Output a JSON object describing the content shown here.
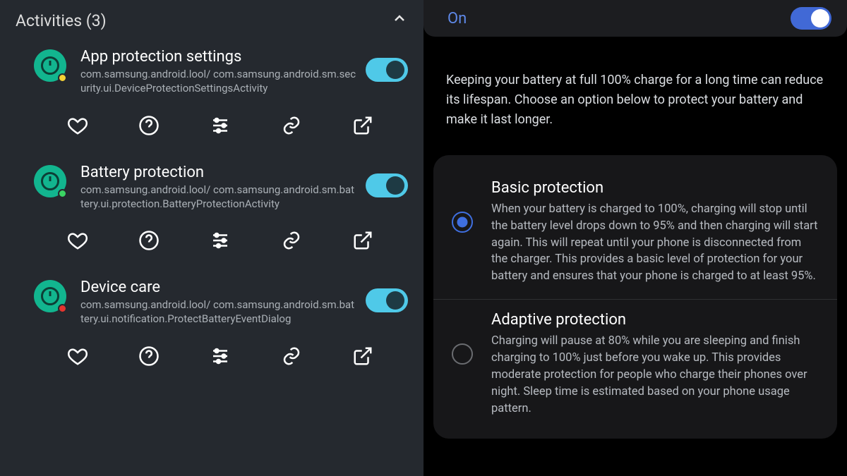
{
  "left": {
    "section_title": "Activities (3)",
    "items": [
      {
        "title": "App protection settings",
        "subtitle": "com.samsung.android.lool/\ncom.samsung.android.sm.security.ui.DeviceProtectionSettingsActivity",
        "dot_color": "#f5d235",
        "enabled": true
      },
      {
        "title": "Battery protection",
        "subtitle": "com.samsung.android.lool/\ncom.samsung.android.sm.battery.ui.protection.BatteryProtectionActivity",
        "dot_color": "#3bd463",
        "enabled": true
      },
      {
        "title": "Device care",
        "subtitle": "com.samsung.android.lool/\ncom.samsung.android.sm.battery.ui.notification.ProtectBatteryEventDialog",
        "dot_color": "#e6352e",
        "enabled": true
      }
    ],
    "action_icons": [
      "heart",
      "help",
      "tune",
      "link",
      "open"
    ]
  },
  "right": {
    "state_label": "On",
    "enabled": true,
    "description": "Keeping your battery at full 100% charge for a long time can reduce its lifespan. Choose an option below to protect your battery and make it last longer.",
    "options": [
      {
        "title": "Basic protection",
        "desc": "When your battery is charged to 100%, charging will stop until the battery level drops down to 95% and then charging will start again. This will repeat until your phone is disconnected from the charger. This provides a basic level of protection for your battery and ensures that your phone is charged to at least 95%.",
        "selected": true
      },
      {
        "title": "Adaptive protection",
        "desc": "Charging will pause at 80% while you are sleeping and finish charging to 100% just before you wake up. This provides moderate protection for people who charge their phones over night. Sleep time is estimated based on your phone usage pattern.",
        "selected": false
      }
    ]
  }
}
